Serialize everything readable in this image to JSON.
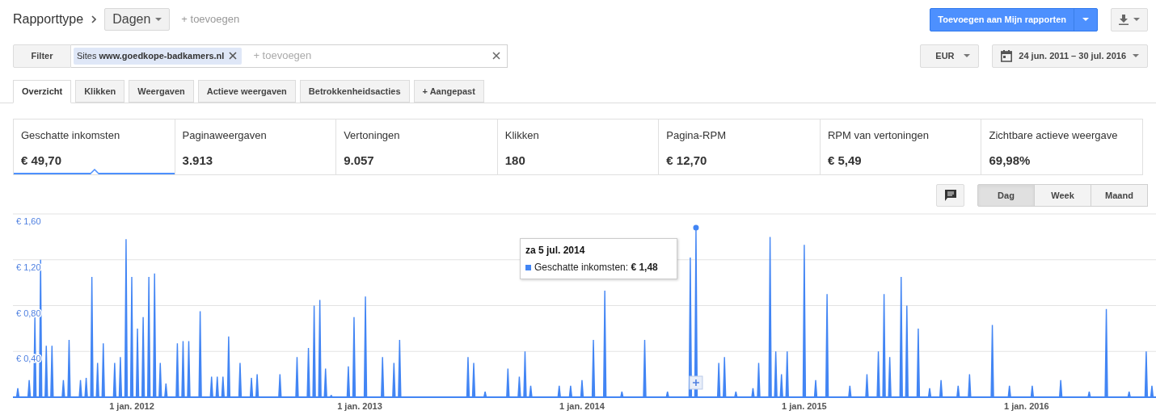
{
  "report_bar": {
    "breadcrumb": "Rapporttype",
    "dimension": "Dagen",
    "add_link": "+ toevoegen",
    "primary_button": "Toevoegen aan Mijn rapporten"
  },
  "filter_bar": {
    "filter_button": "Filter",
    "chips": [
      {
        "text": "Sites **www.goedkope-badkamers.nl**"
      }
    ],
    "placeholder": "+ toevoegen",
    "currency": "EUR",
    "date_range": "24 jun. 2011 – 30 jul. 2016"
  },
  "tabs": [
    {
      "label": "Overzicht",
      "selected": true
    },
    {
      "label": "Klikken",
      "selected": false
    },
    {
      "label": "Weergaven",
      "selected": false
    },
    {
      "label": "Actieve weergaven",
      "selected": false
    },
    {
      "label": "Betrokkenheidsacties",
      "selected": false
    },
    {
      "label": "+ Aangepast",
      "selected": false
    }
  ],
  "metrics": [
    {
      "label": "Geschatte inkomsten",
      "value": "€ 49,70",
      "selected": true
    },
    {
      "label": "Paginaweergaven",
      "value": "3.913",
      "selected": false
    },
    {
      "label": "Vertoningen",
      "value": "9.057",
      "selected": false
    },
    {
      "label": "Klikken",
      "value": "180",
      "selected": false
    },
    {
      "label": "Pagina-RPM",
      "value": "€ 12,70",
      "selected": false
    },
    {
      "label": "RPM van vertoningen",
      "value": "€ 5,49",
      "selected": false
    },
    {
      "label": "Zichtbare actieve weergave",
      "value": "69,98%",
      "selected": false
    }
  ],
  "granularity": [
    {
      "label": "Dag",
      "selected": true
    },
    {
      "label": "Week",
      "selected": false
    },
    {
      "label": "Maand",
      "selected": false
    }
  ],
  "tooltip": {
    "title": "za 5 jul. 2014",
    "text": ": **€ 1,48**"
  },
  "chart_data": {
    "type": "area",
    "ylim": [
      0,
      1.6
    ],
    "grid": true,
    "categories": [
      null,
      null,
      null,
      null,
      null,
      null,
      null,
      null,
      null,
      null,
      null,
      null,
      null,
      null,
      null,
      null,
      null,
      null,
      null,
      null,
      "1 jan. 2012",
      null,
      null,
      null,
      null,
      null,
      null,
      null,
      null,
      null,
      null,
      null,
      null,
      null,
      null,
      null,
      null,
      null,
      null,
      null,
      null,
      null,
      null,
      null,
      null,
      null,
      null,
      null,
      null,
      null,
      null,
      null,
      null,
      null,
      null,
      null,
      null,
      null,
      null,
      null,
      "1 jan. 2013",
      null,
      null,
      null,
      null,
      null,
      null,
      null,
      null,
      null,
      null,
      null,
      null,
      null,
      null,
      null,
      null,
      null,
      null,
      null,
      null,
      null,
      null,
      null,
      null,
      null,
      null,
      null,
      null,
      null,
      null,
      null,
      null,
      null,
      null,
      null,
      null,
      null,
      null,
      "1 jan. 2014",
      null,
      null,
      null,
      null,
      null,
      null,
      null,
      null,
      null,
      null,
      null,
      null,
      null,
      null,
      null,
      null,
      null,
      null,
      null,
      null,
      null,
      null,
      null,
      null,
      null,
      null,
      null,
      null,
      null,
      null,
      null,
      null,
      null,
      null,
      null,
      null,
      null,
      null,
      "1 jan. 2015",
      null,
      null,
      null,
      null,
      null,
      null,
      null,
      null,
      null,
      null,
      null,
      null,
      null,
      null,
      null,
      null,
      null,
      null,
      null,
      null,
      null,
      null,
      null,
      null,
      null,
      null,
      null,
      null,
      null,
      null,
      null,
      null,
      null,
      null,
      null,
      null,
      null,
      null,
      "1 jan. 2016",
      null,
      null,
      null,
      null,
      null,
      null,
      null,
      null,
      null,
      null,
      null,
      null,
      null,
      null,
      null,
      null,
      null,
      null,
      null,
      null,
      null,
      null
    ],
    "yticks": [
      {
        "value": 0.4,
        "label": "€ 0,40"
      },
      {
        "value": 0.8,
        "label": "€ 0,80"
      },
      {
        "value": 1.2,
        "label": "€ 1,20"
      },
      {
        "value": 1.6,
        "label": "€ 1,60"
      }
    ],
    "series": [
      {
        "name": "Geschatte inkomsten",
        "color": "#4285f4",
        "values": [
          0.08,
          0,
          0.15,
          0.7,
          1.2,
          0.45,
          0.45,
          0,
          0.15,
          0.5,
          0,
          0.15,
          0.17,
          1.05,
          0.3,
          0.47,
          0,
          0.3,
          0.35,
          1.38,
          1.05,
          0.6,
          0.7,
          1.05,
          1.08,
          0.3,
          0.12,
          0,
          0.47,
          0.49,
          0.49,
          0,
          0.75,
          0,
          0.18,
          0.18,
          0.18,
          0.53,
          0,
          0.3,
          0,
          0.17,
          0.2,
          0,
          0,
          0,
          0.2,
          0,
          0,
          0.35,
          0,
          0.43,
          0.8,
          0.85,
          0.25,
          0.02,
          0,
          0,
          0.27,
          0.7,
          0,
          0.88,
          0,
          0,
          0.35,
          0,
          0.3,
          0.5,
          0,
          0,
          0,
          0,
          0,
          0,
          0,
          0,
          0,
          0,
          0,
          0.35,
          0.3,
          0,
          0.05,
          0,
          0,
          0,
          0.25,
          0,
          0.18,
          0.4,
          0.1,
          0,
          0,
          0,
          0,
          0.1,
          0,
          0.1,
          0,
          0.15,
          0,
          0.5,
          0,
          0.93,
          0,
          0,
          0.05,
          0,
          0,
          0,
          0.5,
          0,
          0,
          0,
          0.05,
          0,
          0,
          0,
          1.22,
          1.48,
          0,
          0,
          0,
          0.3,
          0.35,
          0,
          0.05,
          0,
          0,
          0.08,
          0.3,
          0,
          1.4,
          0.4,
          0.2,
          0.4,
          0,
          0,
          1.33,
          0,
          0.15,
          0,
          0.9,
          0,
          0,
          0,
          0.1,
          0,
          0,
          0.2,
          0,
          0.4,
          0.9,
          0.35,
          0,
          1.05,
          0.8,
          0,
          0.6,
          0,
          0.08,
          0,
          0.15,
          0,
          0,
          0.1,
          0,
          0.2,
          0,
          0,
          0,
          0.63,
          0,
          0,
          0.1,
          0,
          0,
          0,
          0.1,
          0,
          0,
          0,
          0,
          0.15,
          0,
          0,
          0,
          0,
          0.05,
          0,
          0,
          0.77,
          0,
          0,
          0,
          0.05,
          0,
          0,
          0.4,
          0.1
        ]
      }
    ]
  }
}
